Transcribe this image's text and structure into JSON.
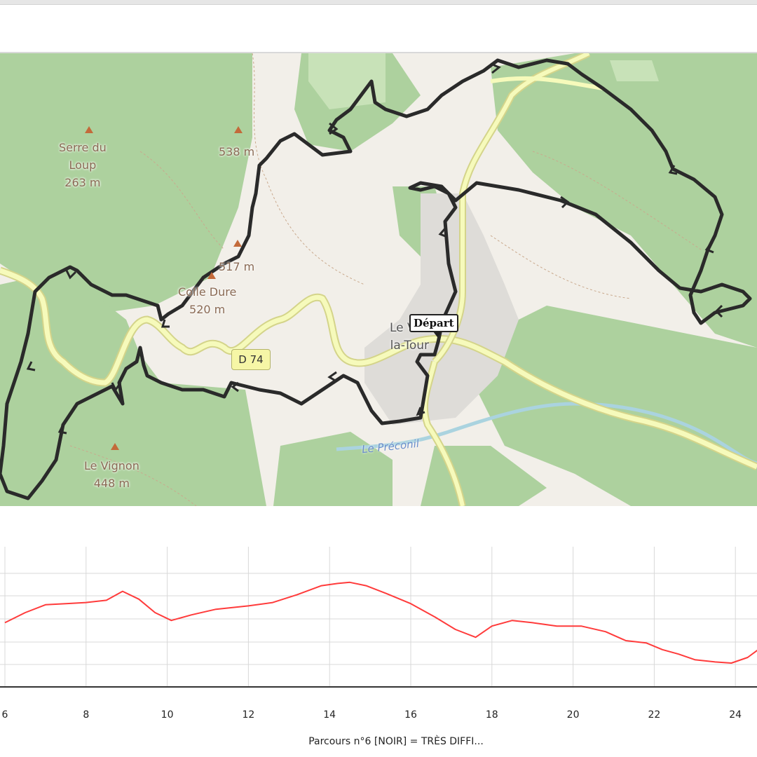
{
  "map": {
    "labels": {
      "serre_du_loup": "Serre du\nLoup\n263 m",
      "peak_538": "538 m",
      "peak_517": "517 m",
      "colle_dure": "Colle Dure\n520 m",
      "le_vignon": "Le Vignon\n448 m",
      "village": "Le Val-\nla-Tour"
    },
    "road_label": "D 74",
    "river_label": "Le Préconil",
    "start_marker": "Départ",
    "colors": {
      "forest": "#add19e",
      "land": "#f2efe9",
      "road": "#f6fabb",
      "road_edge": "#d4d48a",
      "water": "#aad3df",
      "urban": "#dcdcdc",
      "track": "#2a2a2a"
    }
  },
  "chart_data": {
    "type": "line",
    "title": "",
    "xlabel": "",
    "ylabel": "",
    "x_ticks": [
      "6",
      "8",
      "10",
      "12",
      "14",
      "16",
      "18",
      "20",
      "22",
      "24"
    ],
    "xlim": [
      6,
      24.6
    ],
    "series": [
      {
        "name": "",
        "color": "#ff3b3b",
        "x": [
          6.0,
          6.5,
          7.0,
          7.5,
          8.0,
          8.5,
          8.9,
          9.3,
          9.7,
          10.1,
          10.6,
          11.2,
          12.0,
          12.6,
          13.2,
          13.8,
          14.2,
          14.5,
          14.9,
          15.4,
          16.0,
          16.6,
          17.1,
          17.6,
          18.0,
          18.5,
          19.0,
          19.6,
          20.2,
          20.8,
          21.3,
          21.8,
          22.2,
          22.6,
          23.0,
          23.5,
          23.9,
          24.3,
          24.6
        ],
        "elevation_rel": [
          0.46,
          0.55,
          0.62,
          0.63,
          0.64,
          0.66,
          0.74,
          0.67,
          0.55,
          0.48,
          0.53,
          0.58,
          0.61,
          0.64,
          0.71,
          0.79,
          0.81,
          0.82,
          0.79,
          0.72,
          0.63,
          0.51,
          0.4,
          0.33,
          0.43,
          0.48,
          0.46,
          0.43,
          0.43,
          0.38,
          0.3,
          0.28,
          0.22,
          0.18,
          0.13,
          0.11,
          0.1,
          0.15,
          0.23
        ]
      }
    ],
    "grid": true,
    "caption": "Parcours n°6 [NOIR] = TRÈS DIFFI..."
  }
}
